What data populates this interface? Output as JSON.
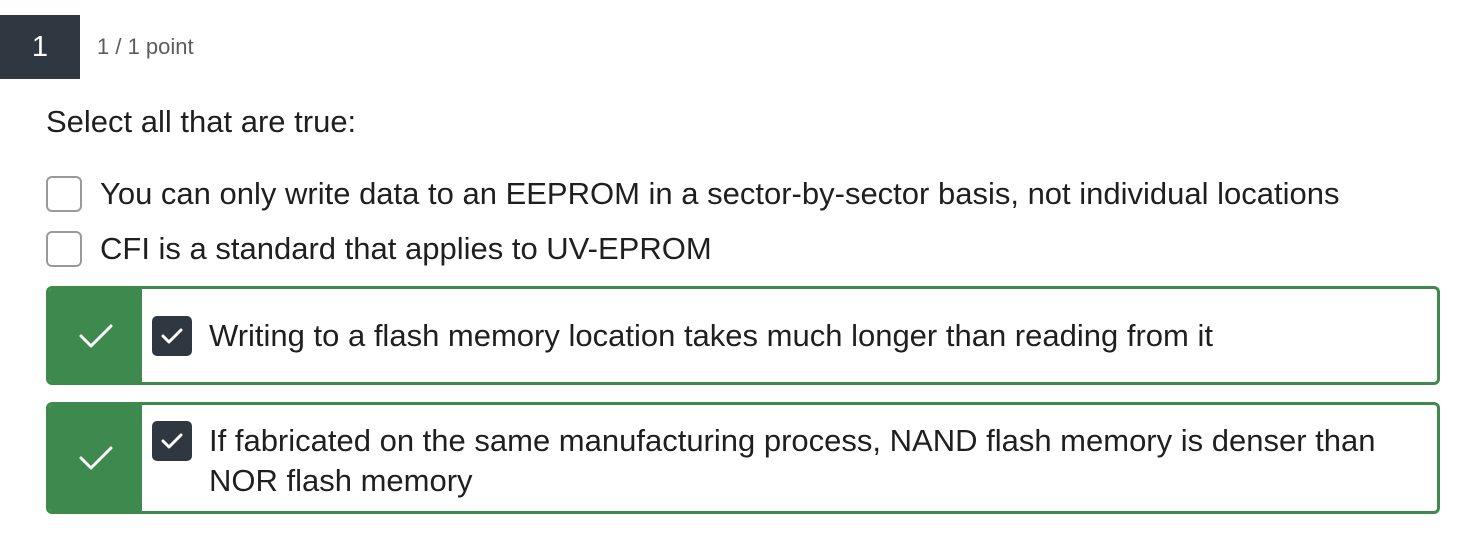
{
  "question": {
    "number": "1",
    "points": "1 / 1 point",
    "prompt": "Select all that are true:"
  },
  "options": [
    {
      "label": "You can only write data to an EEPROM in a sector-by-sector basis, not individual locations",
      "checked": false,
      "correct": false
    },
    {
      "label": "CFI is a standard that applies to UV-EPROM",
      "checked": false,
      "correct": false
    },
    {
      "label": "Writing to a flash memory location takes much longer than reading from it",
      "checked": true,
      "correct": true
    },
    {
      "label": "If fabricated on the same manufacturing process, NAND flash memory is denser than NOR flash memory",
      "checked": true,
      "correct": true
    }
  ],
  "colors": {
    "correct_green": "#3e8a4e",
    "checkbox_dark": "#2f3840",
    "badge_dark": "#2f3840"
  },
  "icons": {
    "status": "checkmark-icon",
    "checkbox": "checkbox-checked-icon"
  }
}
